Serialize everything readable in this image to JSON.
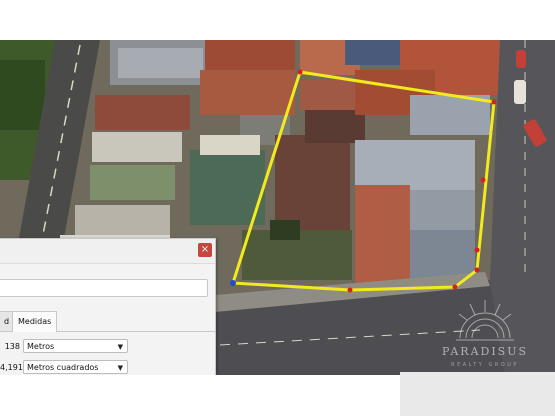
{
  "dialog": {
    "close_glyph": "×",
    "tabs": [
      {
        "label": "d"
      },
      {
        "label": "Medidas"
      }
    ],
    "rows": [
      {
        "value": "138",
        "unit": "Metros"
      },
      {
        "value": "4,191",
        "unit": "Metros cuadrados"
      }
    ]
  },
  "watermark": {
    "brand": "PARADISUS",
    "tagline": "REALTY GROUP"
  },
  "colors": {
    "boundary": "#f2ea1c",
    "vertex": "#d32020",
    "vertex_start": "#1f49d8",
    "close_button": "#c9463d"
  },
  "icons": {
    "close": "close-icon",
    "dropdown": "chevron-down-icon",
    "logo": "sunrise-logo-icon"
  }
}
